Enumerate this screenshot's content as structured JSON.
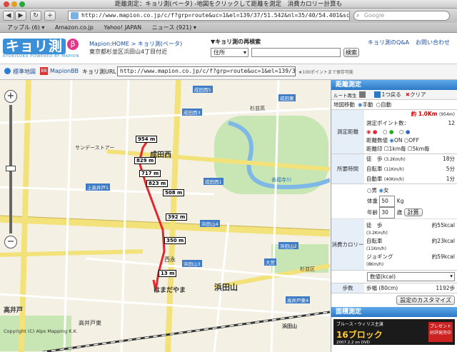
{
  "window": {
    "title": "距離測定：キョリ測(ベータ) -地図をクリックして距離を測定　消費カロリー計算も"
  },
  "browser": {
    "url": "http://www.mapion.co.jp/c/f?grp=route&uc=1&el=139/37/51.542&nl=35/40/54.401&scl=250(",
    "search_placeholder": "Google",
    "back": "◀",
    "forward": "▶",
    "reload": "↻",
    "add": "+",
    "bookmarks": [
      "アップル (6) ▾",
      "Amazon.co.jp",
      "Yahoo! JAPAN",
      "ニュース (921) ▾"
    ]
  },
  "site": {
    "logo": "キョリ測",
    "logo_beta": "β",
    "logo_sub": "KYORISOKU POWERED BY MAPION",
    "breadcrumb": "Mapion:HOME > キョリ測(ベータ)",
    "address": "東京都杉並区浜田山4丁目付近",
    "research_label": "▼キョリ測の再検索",
    "select_value": "住所",
    "search_button": "検索",
    "qa_link": "キョリ測のQ&A",
    "contact_link": "お問い合わせ"
  },
  "toolbar2": {
    "std_map": "標準地図",
    "mapion_bb": "MapionBB",
    "url_label": "キョリ測URL：",
    "url_value": "http://www.mapion.co.jp/c/f?grp=route&uc=1&el=139/37/51.343",
    "note": "★100ポイントまで保存可能"
  },
  "map": {
    "labels": {
      "seibunishi": "成田西",
      "hamadayama": "浜田山",
      "nishi": "西永",
      "takaido": "高井戸",
      "higashi": "高井戸東",
      "hamadayamasta": "はまだやま",
      "suginami": "杉並区",
      "suginamiHigh": "杉並高",
      "zensukji": "善福寺川",
      "sunday": "サンデーストアー",
      "takaidoStation": "高井戸駅",
      "mitsui": "浜田山",
      "copyright": "Copyright (C) Alps Mapping K.K."
    },
    "signs": [
      "成田西5",
      "成田西3",
      "成田西1",
      "成田東",
      "浜田山4",
      "浜田山3",
      "浜田山2",
      "大宮",
      "高井戸東4",
      "上高井戸1"
    ],
    "distances": [
      "954 m",
      "829 m",
      "717 m",
      "823 m",
      "508 m",
      "392 m",
      "350 m",
      "13 m"
    ]
  },
  "panel": {
    "title": "距離測定",
    "route_play": "ルート再生",
    "step_back": "1つ戻る",
    "clear": "クリア",
    "map_move_label": "地図移動",
    "manual": "手動",
    "auto": "自動",
    "distance_label": "測定距離",
    "distance_value": "約 1.0Km",
    "distance_meters": "(954m)",
    "points_label": "測定ポイント数：",
    "points_value": "12",
    "dist_display": "距離数値",
    "on": "ON",
    "off": "OFF",
    "dist_marks": "距離印",
    "km1": "1km毎",
    "km5": "5km毎",
    "time_label": "所要時間",
    "walk": "徒　歩",
    "walk_speed": "(3.2Km/h)",
    "walk_time": "18分",
    "bike": "自転車",
    "bike_speed": "(11Km/h)",
    "bike_time": "5分",
    "car": "自動車",
    "car_speed": "(40Km/h)",
    "car_time": "1分",
    "male": "男",
    "female": "女",
    "weight_label": "体重",
    "weight_value": "50",
    "weight_unit": "Kg",
    "age_label": "年齢",
    "age_value": "30",
    "age_unit": "歳",
    "calc_button": "計算",
    "cal_label": "消費カロリー",
    "cal_walk": "約55kcal",
    "cal_bike": "約23kcal",
    "jog": "ジョギング",
    "jog_speed": "(8Km/h)",
    "cal_jog": "約59kcal",
    "unit_select": "数値(kcal)",
    "steps_label": "歩数",
    "steps_stride": "歩幅 (80cm)",
    "steps_value": "1192歩",
    "customize_button": "設定のカスタマイズ",
    "area_title": "面積測定",
    "ad_title": "ブルース・ウィリス主演",
    "ad_movie": "16ブロック",
    "ad_date": "2007.2.2 on DVD",
    "ad_present": "プレゼント 好評発売中"
  }
}
